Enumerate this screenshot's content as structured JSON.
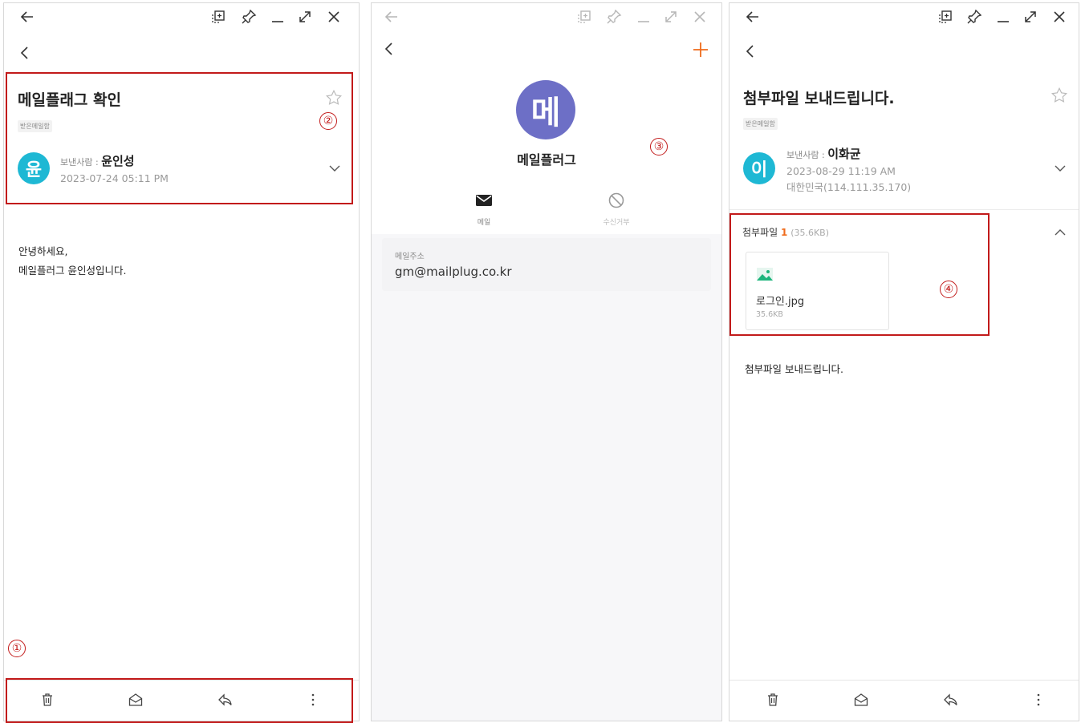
{
  "panel1": {
    "subject": "메일플래그 확인",
    "folder_tag": "받은메일함",
    "sender_label": "보낸사람 : ",
    "sender_name": "윤인성",
    "avatar_char": "윤",
    "date": "2023-07-24 05:11 PM",
    "body_lines": [
      "안녕하세요,",
      "메일플러그 윤인성입니다."
    ],
    "markers": [
      "②",
      "①"
    ]
  },
  "panel2": {
    "avatar_char": "메",
    "contact_name": "메일플러그",
    "actions": [
      {
        "label": "메일",
        "icon": "mail-icon"
      },
      {
        "label": "수신거부",
        "icon": "block-icon"
      }
    ],
    "address_label": "메일주소",
    "address_value": "gm@mailplug.co.kr",
    "marker": "③"
  },
  "panel3": {
    "subject": "첨부파일 보내드립니다.",
    "folder_tag": "받은메일함",
    "sender_label": "보낸사람 : ",
    "sender_name": "이화균",
    "avatar_char": "이",
    "date": "2023-08-29 11:19 AM",
    "location": "대한민국(114.111.35.170)",
    "attachments_label": "첨부파일",
    "attachments_count": "1",
    "attachments_total": "(35.6KB)",
    "attachment": {
      "name": "로그인.jpg",
      "size": "35.6KB"
    },
    "body_text": "첨부파일 보내드립니다.",
    "marker": "④"
  },
  "colors": {
    "accent_orange": "#ef6b1b",
    "avatar_teal": "#1eb8d4",
    "contact_purple": "#6d6fc6",
    "annotation_red": "#c21a1a"
  },
  "icons": {
    "titlebar": [
      "back-arrow-icon",
      "capture-icon",
      "pin-icon",
      "minimize-icon",
      "expand-icon",
      "close-icon"
    ],
    "bottombar": [
      "trash-icon",
      "envelope-open-icon",
      "reply-icon",
      "more-vertical-icon"
    ]
  }
}
